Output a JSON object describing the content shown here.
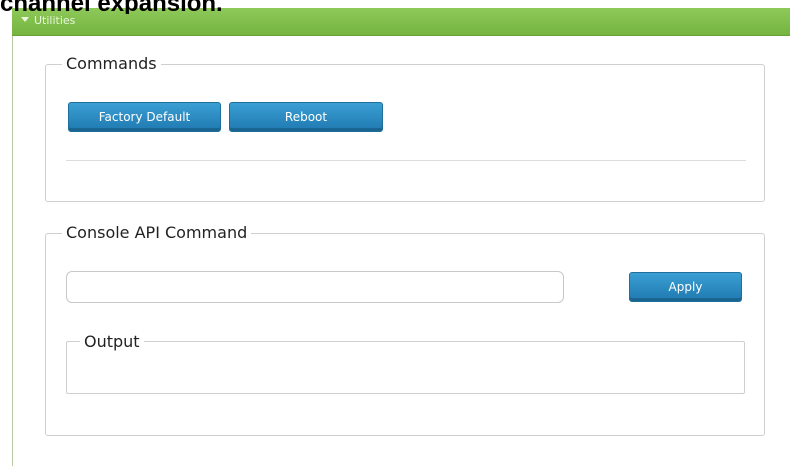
{
  "caption": "channel expansion.",
  "panel": {
    "title": "Utilities"
  },
  "commands": {
    "legend": "Commands",
    "factory_default_label": "Factory Default",
    "reboot_label": "Reboot"
  },
  "console": {
    "legend": "Console API Command",
    "input_value": "",
    "apply_label": "Apply",
    "output_legend": "Output",
    "output_text": ""
  },
  "colors": {
    "header_green": "#7fbd49",
    "button_blue": "#2a8bc4",
    "border_gray": "#cfcfcf"
  }
}
